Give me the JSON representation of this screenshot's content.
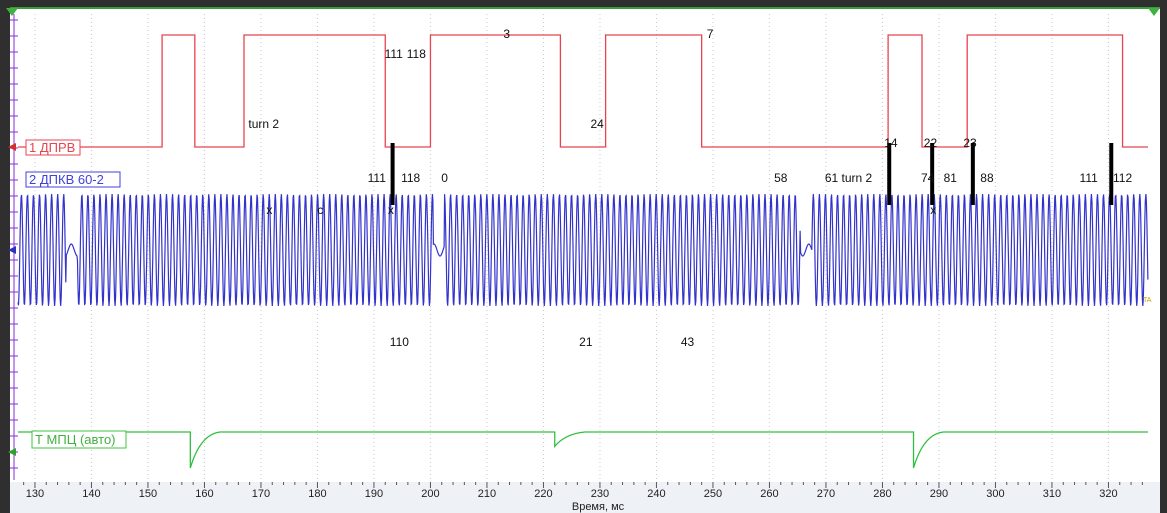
{
  "chart_data": {
    "type": "line",
    "title": "",
    "xlabel": "Время, мс",
    "ylabel": "",
    "xlim": [
      127,
      327
    ],
    "x_ticks": [
      130,
      140,
      150,
      160,
      170,
      180,
      190,
      200,
      210,
      220,
      230,
      240,
      250,
      260,
      270,
      280,
      290,
      300,
      310,
      320
    ],
    "grid": "on (dotted vertical)",
    "series": [
      {
        "name": "1 ДПРВ",
        "color": "#e8434f",
        "kind": "square",
        "level_low": 0,
        "level_high": 1,
        "transitions_ms": [
          [
            0,
            127
          ],
          [
            1,
            152.5
          ],
          [
            0,
            158.3
          ],
          [
            1,
            167
          ],
          [
            0,
            192
          ],
          [
            1,
            200
          ],
          [
            0,
            223
          ],
          [
            1,
            231
          ],
          [
            0,
            248
          ],
          [
            1,
            281
          ],
          [
            0,
            287
          ],
          [
            1,
            295
          ],
          [
            0,
            322.5
          ]
        ]
      },
      {
        "name": "2 ДПКВ 60-2",
        "color": "#3333cc",
        "kind": "sine",
        "period_ms": 1.07,
        "gaps_ms": [
          [
            135.5,
            137.5
          ],
          [
            200.5,
            202.5
          ],
          [
            265.5,
            267.5
          ]
        ]
      },
      {
        "name": "Т МПЦ (авто)",
        "color": "#30c040",
        "kind": "baseline_with_dips",
        "dips_ms": [
          157.5,
          222,
          285.5
        ],
        "dip_depths": [
          1.0,
          0.4,
          1.0
        ]
      }
    ],
    "annotations": [
      {
        "text": "111",
        "x": 193.5,
        "row": "upper"
      },
      {
        "text": "118",
        "x": 197.5,
        "row": "upper"
      },
      {
        "text": "3",
        "x": 213.5,
        "row": "top"
      },
      {
        "text": "7",
        "x": 249.5,
        "row": "top"
      },
      {
        "text": "turn 2",
        "x": 170.5,
        "row": "mid"
      },
      {
        "text": "24",
        "x": 229.5,
        "row": "mid"
      },
      {
        "text": "111",
        "x": 190.5,
        "row": "lower"
      },
      {
        "text": "118",
        "x": 196.5,
        "row": "lower"
      },
      {
        "text": "0",
        "x": 202.5,
        "row": "lower"
      },
      {
        "text": "14",
        "x": 281.5,
        "row": "mid2"
      },
      {
        "text": "22",
        "x": 288.5,
        "row": "mid2"
      },
      {
        "text": "23",
        "x": 295.5,
        "row": "mid2"
      },
      {
        "text": "58",
        "x": 262.0,
        "row": "lower"
      },
      {
        "text": "61 turn 2",
        "x": 274.0,
        "row": "lower"
      },
      {
        "text": "74",
        "x": 288.0,
        "row": "lower"
      },
      {
        "text": "81",
        "x": 292.0,
        "row": "lower"
      },
      {
        "text": "88",
        "x": 298.5,
        "row": "lower"
      },
      {
        "text": "111",
        "x": 316.5,
        "row": "lower"
      },
      {
        "text": "112",
        "x": 322.5,
        "row": "lower"
      },
      {
        "text": "x",
        "x": 171.5,
        "row": "sine"
      },
      {
        "text": "c",
        "x": 180.5,
        "row": "sine"
      },
      {
        "text": "x",
        "x": 193.0,
        "row": "sine"
      },
      {
        "text": "x",
        "x": 289.0,
        "row": "sine"
      },
      {
        "text": "110",
        "x": 194.5,
        "row": "below"
      },
      {
        "text": "21",
        "x": 227.5,
        "row": "below"
      },
      {
        "text": "43",
        "x": 245.5,
        "row": "below"
      }
    ],
    "markers_ms": [
      193.3,
      281.2,
      288.8,
      296.0,
      320.5
    ]
  },
  "labels": {
    "ch1": "1 ДПРВ",
    "ch2": "2 ДПКВ 60-2",
    "ch3": "Т МПЦ (авто)",
    "xaxis": "Время, мс"
  }
}
